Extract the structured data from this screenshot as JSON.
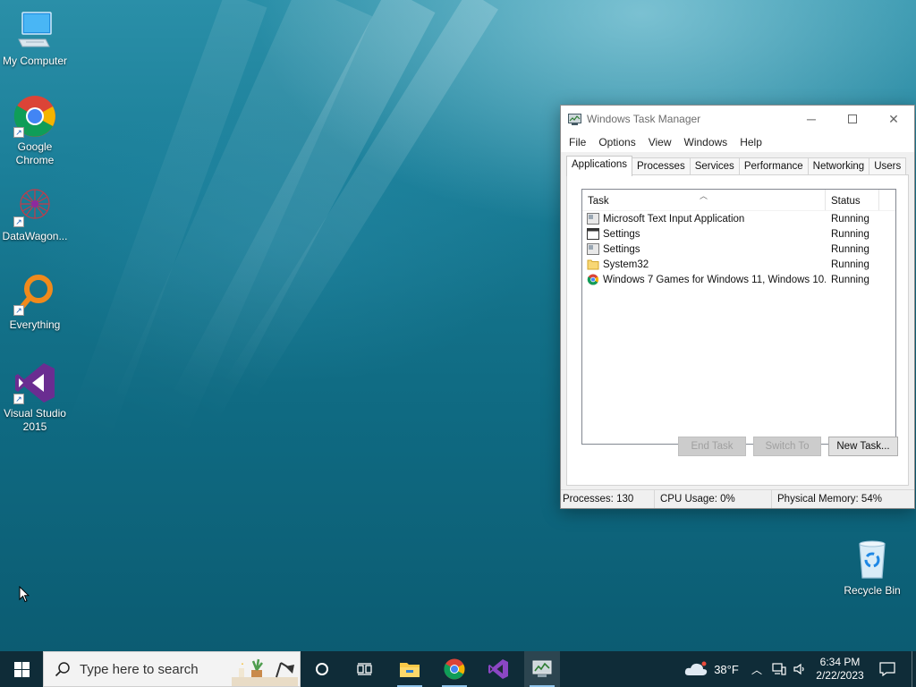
{
  "desktop": {
    "icons": [
      {
        "label": "My Computer",
        "icon": "computer-icon"
      },
      {
        "label": "Google Chrome",
        "icon": "chrome-icon"
      },
      {
        "label": "DataWagon...",
        "icon": "datawagon-icon"
      },
      {
        "label": "Everything",
        "icon": "everything-search-icon"
      },
      {
        "label": "Visual Studio 2015",
        "icon": "visual-studio-icon"
      },
      {
        "label": "Recycle Bin",
        "icon": "recycle-bin-icon"
      }
    ]
  },
  "task_manager": {
    "title": "Windows Task Manager",
    "menu": [
      "File",
      "Options",
      "View",
      "Windows",
      "Help"
    ],
    "tabs": [
      "Applications",
      "Processes",
      "Services",
      "Performance",
      "Networking",
      "Users"
    ],
    "active_tab": "Applications",
    "columns": {
      "task": "Task",
      "status": "Status"
    },
    "rows": [
      {
        "task": "Microsoft Text Input Application",
        "status": "Running",
        "icon": "window-app-icon"
      },
      {
        "task": "Settings",
        "status": "Running",
        "icon": "settings-window-icon"
      },
      {
        "task": "Settings",
        "status": "Running",
        "icon": "window-app-icon"
      },
      {
        "task": "System32",
        "status": "Running",
        "icon": "folder-icon"
      },
      {
        "task": "Windows 7 Games for Windows 11, Windows 10...",
        "status": "Running",
        "icon": "chrome-icon"
      }
    ],
    "buttons": {
      "end_task": "End Task",
      "switch_to": "Switch To",
      "new_task": "New Task..."
    },
    "statusbar": {
      "processes": "Processes: 130",
      "cpu": "CPU Usage: 0%",
      "memory": "Physical Memory: 54%"
    }
  },
  "taskbar": {
    "search_placeholder": "Type here to search",
    "pinned": [
      "file-explorer-icon",
      "chrome-icon",
      "visual-studio-icon",
      "task-manager-icon"
    ],
    "weather": "38°F",
    "time": "6:34 PM",
    "date": "2/22/2023"
  },
  "colors": {
    "taskbar": "#102530",
    "window_bg": "#f0f0f0",
    "accent_underline": "#8fc3ea"
  }
}
